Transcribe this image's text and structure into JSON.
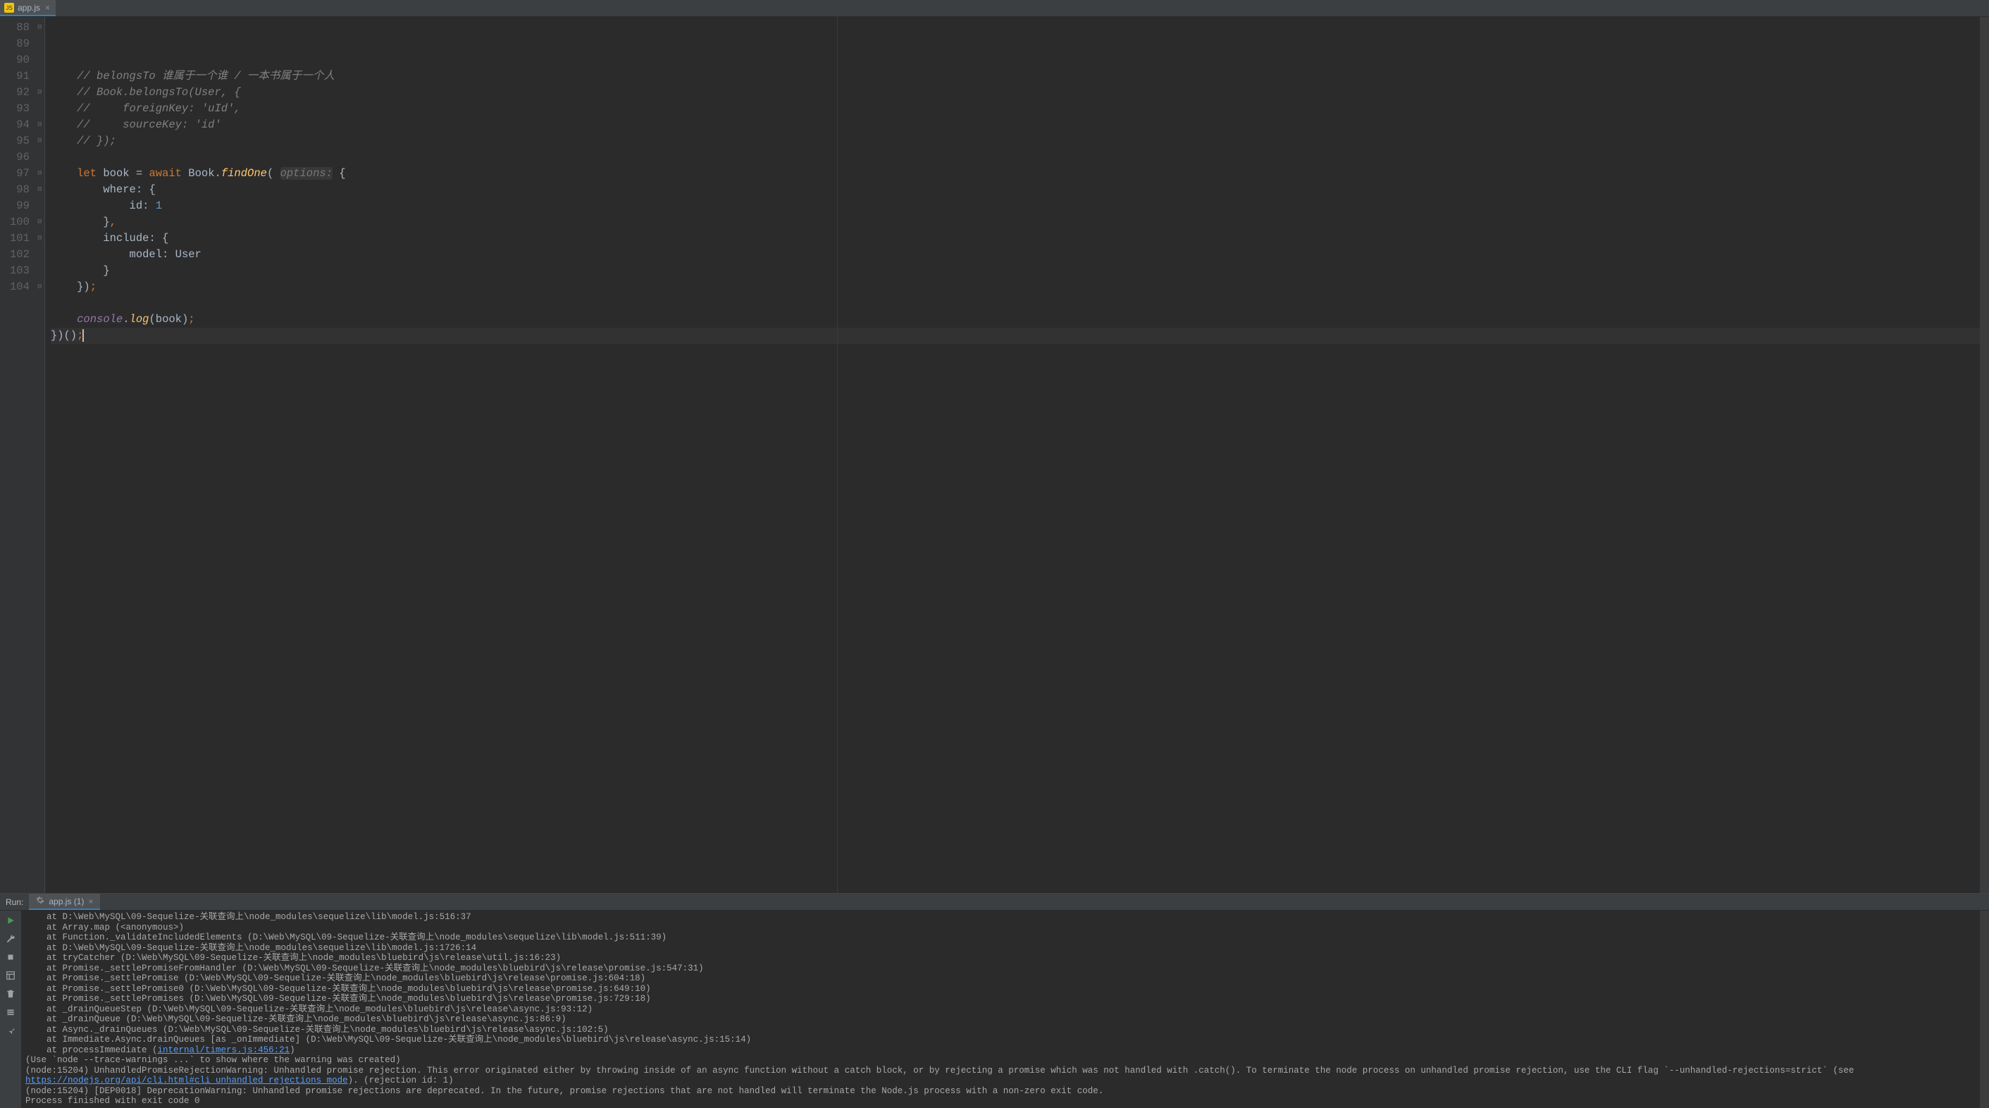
{
  "tab": {
    "filename": "app.js",
    "icon": "js-file-icon",
    "close": "×"
  },
  "editor": {
    "first_line": 88,
    "lines": [
      {
        "n": 88,
        "t": "comment",
        "text": "    // belongsTo 谁属于一个谁 / 一本书属于一个人"
      },
      {
        "n": 89,
        "t": "comment",
        "text": "    // Book.belongsTo(User, {"
      },
      {
        "n": 90,
        "t": "comment",
        "text": "    //     foreignKey: 'uId',"
      },
      {
        "n": 91,
        "t": "comment",
        "text": "    //     sourceKey: 'id'"
      },
      {
        "n": 92,
        "t": "comment",
        "text": "    // });"
      },
      {
        "n": 93,
        "t": "blank",
        "text": ""
      },
      {
        "n": 94,
        "t": "code",
        "seg": [
          [
            "plain",
            "    "
          ],
          [
            "kw",
            "let"
          ],
          [
            "plain",
            " "
          ],
          [
            "ident",
            "book "
          ],
          [
            "plain",
            "= "
          ],
          [
            "kw",
            "await"
          ],
          [
            "plain",
            " "
          ],
          [
            "ident",
            "Book"
          ],
          [
            "plain",
            "."
          ],
          [
            "member",
            "findOne"
          ],
          [
            "plain",
            "( "
          ],
          [
            "paramhint",
            "options:"
          ],
          [
            "plain",
            " {"
          ]
        ]
      },
      {
        "n": 95,
        "t": "code",
        "seg": [
          [
            "plain",
            "        "
          ],
          [
            "ident",
            "where"
          ],
          [
            "plain",
            ": {"
          ]
        ]
      },
      {
        "n": 96,
        "t": "code",
        "seg": [
          [
            "plain",
            "            "
          ],
          [
            "ident",
            "id"
          ],
          [
            "plain",
            ": "
          ],
          [
            "num",
            "1"
          ]
        ]
      },
      {
        "n": 97,
        "t": "code",
        "seg": [
          [
            "plain",
            "        }"
          ],
          [
            "punct",
            ","
          ]
        ]
      },
      {
        "n": 98,
        "t": "code",
        "seg": [
          [
            "plain",
            "        "
          ],
          [
            "ident",
            "include"
          ],
          [
            "plain",
            ": {"
          ]
        ]
      },
      {
        "n": 99,
        "t": "code",
        "seg": [
          [
            "plain",
            "            "
          ],
          [
            "ident",
            "model"
          ],
          [
            "plain",
            ": "
          ],
          [
            "ident",
            "User"
          ]
        ]
      },
      {
        "n": 100,
        "t": "code",
        "seg": [
          [
            "plain",
            "        }"
          ]
        ]
      },
      {
        "n": 101,
        "t": "code",
        "seg": [
          [
            "plain",
            "    })"
          ],
          [
            "punct",
            ";"
          ]
        ]
      },
      {
        "n": 102,
        "t": "blank",
        "text": ""
      },
      {
        "n": 103,
        "t": "code",
        "seg": [
          [
            "plain",
            "    "
          ],
          [
            "global",
            "console"
          ],
          [
            "plain",
            "."
          ],
          [
            "member",
            "log"
          ],
          [
            "plain",
            "(book)"
          ],
          [
            "punct",
            ";"
          ]
        ]
      },
      {
        "n": 104,
        "t": "caret",
        "seg": [
          [
            "plain",
            "})()"
          ],
          [
            "punct",
            ";"
          ]
        ]
      }
    ]
  },
  "run": {
    "title": "Run:",
    "tab": "app.js (1)",
    "tab_close": "×",
    "lines": [
      "    at D:\\Web\\MySQL\\09-Sequelize-关联查询上\\node_modules\\sequelize\\lib\\model.js:516:37",
      "    at Array.map (<anonymous>)",
      "    at Function._validateIncludedElements (D:\\Web\\MySQL\\09-Sequelize-关联查询上\\node_modules\\sequelize\\lib\\model.js:511:39)",
      "    at D:\\Web\\MySQL\\09-Sequelize-关联查询上\\node_modules\\sequelize\\lib\\model.js:1726:14",
      "    at tryCatcher (D:\\Web\\MySQL\\09-Sequelize-关联查询上\\node_modules\\bluebird\\js\\release\\util.js:16:23)",
      "    at Promise._settlePromiseFromHandler (D:\\Web\\MySQL\\09-Sequelize-关联查询上\\node_modules\\bluebird\\js\\release\\promise.js:547:31)",
      "    at Promise._settlePromise (D:\\Web\\MySQL\\09-Sequelize-关联查询上\\node_modules\\bluebird\\js\\release\\promise.js:604:18)",
      "    at Promise._settlePromise0 (D:\\Web\\MySQL\\09-Sequelize-关联查询上\\node_modules\\bluebird\\js\\release\\promise.js:649:10)",
      "    at Promise._settlePromises (D:\\Web\\MySQL\\09-Sequelize-关联查询上\\node_modules\\bluebird\\js\\release\\promise.js:729:18)",
      "    at _drainQueueStep (D:\\Web\\MySQL\\09-Sequelize-关联查询上\\node_modules\\bluebird\\js\\release\\async.js:93:12)",
      "    at _drainQueue (D:\\Web\\MySQL\\09-Sequelize-关联查询上\\node_modules\\bluebird\\js\\release\\async.js:86:9)",
      "    at Async._drainQueues (D:\\Web\\MySQL\\09-Sequelize-关联查询上\\node_modules\\bluebird\\js\\release\\async.js:102:5)",
      "    at Immediate.Async.drainQueues [as _onImmediate] (D:\\Web\\MySQL\\09-Sequelize-关联查询上\\node_modules\\bluebird\\js\\release\\async.js:15:14)",
      "    at processImmediate (<LINK>internal/timers.js:456:21</LINK>)",
      "(Use `node --trace-warnings ...` to show where the warning was created)",
      "(node:15204) UnhandledPromiseRejectionWarning: Unhandled promise rejection. This error originated either by throwing inside of an async function without a catch block, or by rejecting a promise which was not handled with .catch(). To terminate the node process on unhandled promise rejection, use the CLI flag `--unhandled-rejections=strict` (see <LINK>https://nodejs.org/api/cli.html#cli_unhandled_rejections_mode</LINK>). (rejection id: 1)",
      "(node:15204) [DEP0018] DeprecationWarning: Unhandled promise rejections are deprecated. In the future, promise rejections that are not handled will terminate the Node.js process with a non-zero exit code.",
      "",
      "Process finished with exit code 0"
    ]
  },
  "toolbar_icons": [
    "play",
    "wrench",
    "stop",
    "layout",
    "trash",
    "stack",
    "pin"
  ]
}
